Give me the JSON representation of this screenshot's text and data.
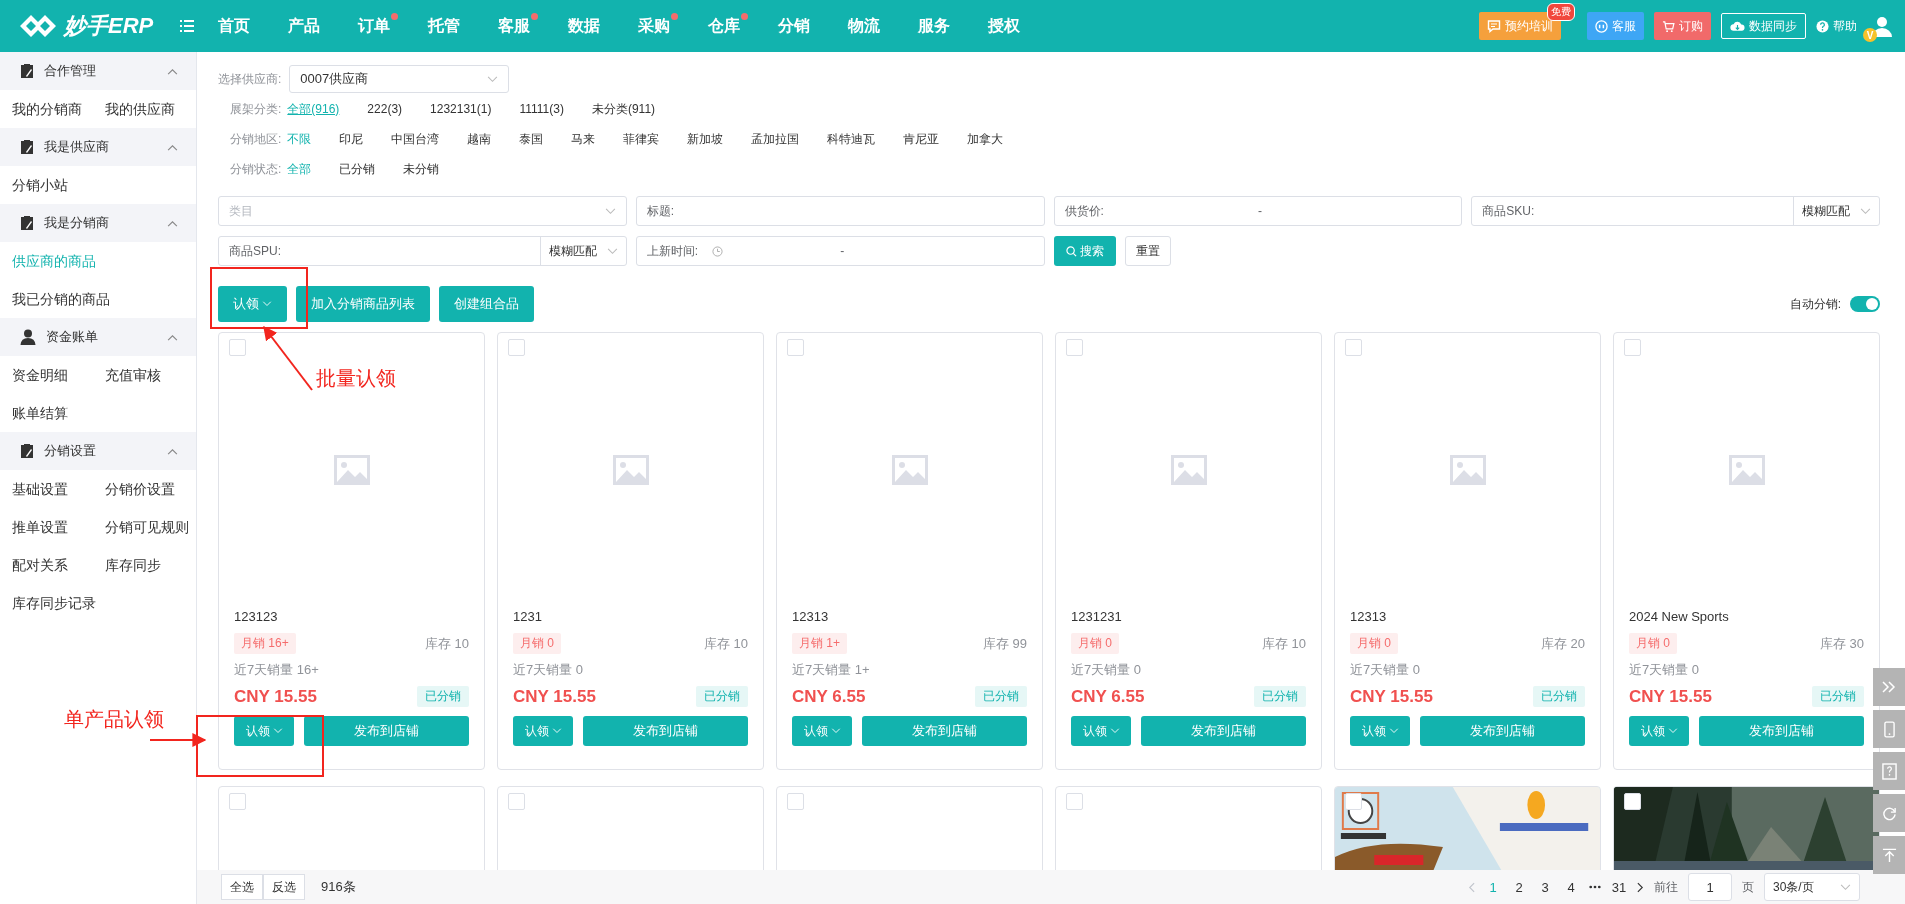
{
  "header": {
    "logo": "妙手ERP",
    "nav": [
      {
        "label": "首页",
        "dot": false
      },
      {
        "label": "产品",
        "dot": false
      },
      {
        "label": "订单",
        "dot": true
      },
      {
        "label": "托管",
        "dot": false
      },
      {
        "label": "客服",
        "dot": true
      },
      {
        "label": "数据",
        "dot": false
      },
      {
        "label": "采购",
        "dot": true
      },
      {
        "label": "仓库",
        "dot": true
      },
      {
        "label": "分销",
        "dot": false
      },
      {
        "label": "物流",
        "dot": false
      },
      {
        "label": "服务",
        "dot": false
      },
      {
        "label": "授权",
        "dot": false
      }
    ],
    "actions": [
      {
        "kind": "training",
        "label": "预约培训",
        "badge": "免费"
      },
      {
        "kind": "service",
        "label": "客服"
      },
      {
        "kind": "order",
        "label": "订购"
      },
      {
        "kind": "sync",
        "label": "数据同步"
      },
      {
        "kind": "help",
        "label": "帮助"
      }
    ],
    "avatar_badge": "V"
  },
  "sidebar": [
    {
      "title": "合作管理",
      "expanded": true,
      "items": [
        {
          "label": "我的分销商",
          "selected": false
        },
        {
          "label": "我的供应商",
          "selected": false
        }
      ]
    },
    {
      "title": "我是供应商",
      "expanded": true,
      "items": [
        {
          "label": "分销小站",
          "selected": false
        }
      ]
    },
    {
      "title": "我是分销商",
      "expanded": true,
      "items": [
        {
          "label": "供应商的商品",
          "selected": true
        },
        {
          "label": "我已分销的商品",
          "selected": false
        }
      ]
    },
    {
      "title": "资金账单",
      "expanded": true,
      "items": [
        {
          "label": "资金明细",
          "selected": false
        },
        {
          "label": "充值审核",
          "selected": false
        },
        {
          "label": "账单结算",
          "selected": false
        }
      ]
    },
    {
      "title": "分销设置",
      "expanded": true,
      "items": [
        {
          "label": "基础设置",
          "selected": false
        },
        {
          "label": "分销价设置",
          "selected": false
        },
        {
          "label": "推单设置",
          "selected": false
        },
        {
          "label": "分销可见规则",
          "selected": false
        },
        {
          "label": "配对关系",
          "selected": false
        },
        {
          "label": "库存同步",
          "selected": false
        },
        {
          "label": "库存同步记录",
          "selected": false
        }
      ]
    }
  ],
  "supplier": {
    "label": "选择供应商:",
    "value": "0007供应商"
  },
  "filters": [
    {
      "kind": "category",
      "label": "展架分类:",
      "options": [
        {
          "label": "全部(916)",
          "selected": true
        },
        {
          "label": "222(3)",
          "selected": false
        },
        {
          "label": "1232131(1)",
          "selected": false
        },
        {
          "label": "11111(3)",
          "selected": false
        },
        {
          "label": "未分类(911)",
          "selected": false
        }
      ]
    },
    {
      "kind": "plain",
      "label": "分销地区:",
      "options": [
        {
          "label": "不限",
          "selected": true
        },
        {
          "label": "印尼",
          "selected": false
        },
        {
          "label": "中国台湾",
          "selected": false
        },
        {
          "label": "越南",
          "selected": false
        },
        {
          "label": "泰国",
          "selected": false
        },
        {
          "label": "马来",
          "selected": false
        },
        {
          "label": "菲律宾",
          "selected": false
        },
        {
          "label": "新加坡",
          "selected": false
        },
        {
          "label": "孟加拉国",
          "selected": false
        },
        {
          "label": "科特迪瓦",
          "selected": false
        },
        {
          "label": "肯尼亚",
          "selected": false
        },
        {
          "label": "加拿大",
          "selected": false
        }
      ]
    },
    {
      "kind": "plain",
      "label": "分销状态:",
      "options": [
        {
          "label": "全部",
          "selected": true
        },
        {
          "label": "已分销",
          "selected": false
        },
        {
          "label": "未分销",
          "selected": false
        }
      ]
    }
  ],
  "search_fields": [
    {
      "kind": "select",
      "placeholder": "类目"
    },
    {
      "kind": "text",
      "label": "标题:"
    },
    {
      "kind": "range",
      "label": "供货价:",
      "separator": "-"
    },
    {
      "kind": "match",
      "label": "商品SKU:",
      "match": "模糊匹配"
    },
    {
      "kind": "match",
      "label": "商品SPU:",
      "match": "模糊匹配"
    },
    {
      "kind": "date",
      "label": "上新时间:",
      "separator": "-"
    }
  ],
  "search_button": "搜索",
  "reset_button": "重置",
  "toolbar": {
    "claim": "认领",
    "add": "加入分销商品列表",
    "combo": "创建组合品",
    "auto_label": "自动分销:",
    "auto_on": true
  },
  "products": [
    {
      "title": "123123",
      "monthly": "月销 16+",
      "stock": "库存 10",
      "week": "近7天销量 16+",
      "price": "CNY 15.55",
      "tag": "已分销",
      "claim": "认领",
      "publish": "发布到店铺",
      "checked": false
    },
    {
      "title": "1231",
      "monthly": "月销 0",
      "stock": "库存 10",
      "week": "近7天销量 0",
      "price": "CNY 15.55",
      "tag": "已分销",
      "claim": "认领",
      "publish": "发布到店铺",
      "checked": false
    },
    {
      "title": "12313",
      "monthly": "月销 1+",
      "stock": "库存 99",
      "week": "近7天销量 1+",
      "price": "CNY 6.55",
      "tag": "已分销",
      "claim": "认领",
      "publish": "发布到店铺",
      "checked": false
    },
    {
      "title": "1231231",
      "monthly": "月销 0",
      "stock": "库存 10",
      "week": "近7天销量 0",
      "price": "CNY 6.55",
      "tag": "已分销",
      "claim": "认领",
      "publish": "发布到店铺",
      "checked": false
    },
    {
      "title": "12313",
      "monthly": "月销 0",
      "stock": "库存 20",
      "week": "近7天销量 0",
      "price": "CNY 15.55",
      "tag": "已分销",
      "claim": "认领",
      "publish": "发布到店铺",
      "checked": false
    },
    {
      "title": "2024 New Sports",
      "monthly": "月销 0",
      "stock": "库存 30",
      "week": "近7天销量 0",
      "price": "CNY 15.55",
      "tag": "已分销",
      "claim": "认领",
      "publish": "发布到店铺",
      "checked": false
    }
  ],
  "more_products": [
    {
      "kind": "empty",
      "checked": false
    },
    {
      "kind": "empty",
      "checked": false
    },
    {
      "kind": "empty",
      "checked": false
    },
    {
      "kind": "empty",
      "checked": false
    },
    {
      "kind": "picture",
      "checked": false
    },
    {
      "kind": "picture",
      "checked": false
    }
  ],
  "footer": {
    "select_all": "全选",
    "invert": "反选",
    "total": "916条",
    "pages": [
      {
        "label": "1",
        "selected": true
      },
      {
        "label": "2",
        "selected": false
      },
      {
        "label": "3",
        "selected": false
      },
      {
        "label": "4",
        "selected": false
      },
      {
        "label": "31",
        "selected": false
      }
    ],
    "goto": "前往",
    "page_value": "1",
    "page_unit": "页",
    "page_size": "30条/页"
  },
  "annotations": [
    {
      "text": "批量认领"
    },
    {
      "text": "单产品认领"
    }
  ]
}
